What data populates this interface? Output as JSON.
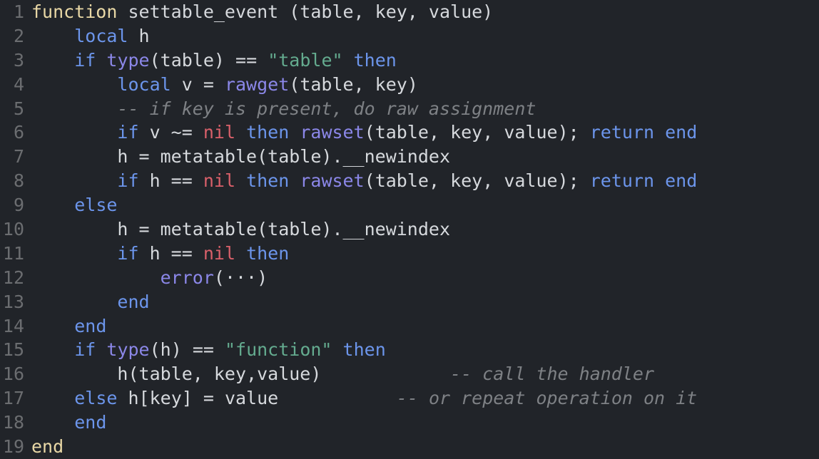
{
  "editor": {
    "language": "lua",
    "background_color": "#212429",
    "gutter_color": "#6b6d70",
    "default_text_color": "#d6d9dd",
    "colors": {
      "keyword": "#6c95eb",
      "function": "#8b87e8",
      "string": "#64ab8f",
      "constant_nil": "#d9606a",
      "definition": "#e9d8a6",
      "comment": "#7e8185"
    },
    "lines": [
      {
        "number": "1",
        "indent": 0,
        "tokens": [
          {
            "text": "function",
            "type": "def"
          },
          {
            "text": " settable_event (table, key, value)",
            "type": "plain"
          }
        ]
      },
      {
        "number": "2",
        "indent": 4,
        "tokens": [
          {
            "text": "local",
            "type": "kw"
          },
          {
            "text": " h",
            "type": "plain"
          }
        ]
      },
      {
        "number": "3",
        "indent": 4,
        "tokens": [
          {
            "text": "if",
            "type": "kw"
          },
          {
            "text": " ",
            "type": "plain"
          },
          {
            "text": "type",
            "type": "fn"
          },
          {
            "text": "(table) == ",
            "type": "plain"
          },
          {
            "text": "\"table\"",
            "type": "str"
          },
          {
            "text": " ",
            "type": "plain"
          },
          {
            "text": "then",
            "type": "kw"
          }
        ]
      },
      {
        "number": "4",
        "indent": 8,
        "tokens": [
          {
            "text": "local",
            "type": "kw"
          },
          {
            "text": " v = ",
            "type": "plain"
          },
          {
            "text": "rawget",
            "type": "fn"
          },
          {
            "text": "(table, key)",
            "type": "plain"
          }
        ]
      },
      {
        "number": "5",
        "indent": 8,
        "tokens": [
          {
            "text": "-- if key is present, do raw assignment",
            "type": "com"
          }
        ]
      },
      {
        "number": "6",
        "indent": 8,
        "tokens": [
          {
            "text": "if",
            "type": "kw"
          },
          {
            "text": " v ~= ",
            "type": "plain"
          },
          {
            "text": "nil",
            "type": "nil"
          },
          {
            "text": " ",
            "type": "plain"
          },
          {
            "text": "then",
            "type": "kw"
          },
          {
            "text": " ",
            "type": "plain"
          },
          {
            "text": "rawset",
            "type": "fn"
          },
          {
            "text": "(table, key, value); ",
            "type": "plain"
          },
          {
            "text": "return",
            "type": "kw"
          },
          {
            "text": " ",
            "type": "plain"
          },
          {
            "text": "end",
            "type": "kw"
          }
        ]
      },
      {
        "number": "7",
        "indent": 8,
        "tokens": [
          {
            "text": "h = metatable(table).__newindex",
            "type": "plain"
          }
        ]
      },
      {
        "number": "8",
        "indent": 8,
        "tokens": [
          {
            "text": "if",
            "type": "kw"
          },
          {
            "text": " h == ",
            "type": "plain"
          },
          {
            "text": "nil",
            "type": "nil"
          },
          {
            "text": " ",
            "type": "plain"
          },
          {
            "text": "then",
            "type": "kw"
          },
          {
            "text": " ",
            "type": "plain"
          },
          {
            "text": "rawset",
            "type": "fn"
          },
          {
            "text": "(table, key, value); ",
            "type": "plain"
          },
          {
            "text": "return",
            "type": "kw"
          },
          {
            "text": " ",
            "type": "plain"
          },
          {
            "text": "end",
            "type": "kw"
          }
        ]
      },
      {
        "number": "9",
        "indent": 4,
        "tokens": [
          {
            "text": "else",
            "type": "kw"
          }
        ]
      },
      {
        "number": "10",
        "indent": 8,
        "tokens": [
          {
            "text": "h = metatable(table).__newindex",
            "type": "plain"
          }
        ]
      },
      {
        "number": "11",
        "indent": 8,
        "tokens": [
          {
            "text": "if",
            "type": "kw"
          },
          {
            "text": " h == ",
            "type": "plain"
          },
          {
            "text": "nil",
            "type": "nil"
          },
          {
            "text": " ",
            "type": "plain"
          },
          {
            "text": "then",
            "type": "kw"
          }
        ]
      },
      {
        "number": "12",
        "indent": 12,
        "tokens": [
          {
            "text": "error",
            "type": "fn"
          },
          {
            "text": "(···)",
            "type": "plain"
          }
        ]
      },
      {
        "number": "13",
        "indent": 8,
        "tokens": [
          {
            "text": "end",
            "type": "kw"
          }
        ]
      },
      {
        "number": "14",
        "indent": 4,
        "tokens": [
          {
            "text": "end",
            "type": "kw"
          }
        ]
      },
      {
        "number": "15",
        "indent": 4,
        "tokens": [
          {
            "text": "if",
            "type": "kw"
          },
          {
            "text": " ",
            "type": "plain"
          },
          {
            "text": "type",
            "type": "fn"
          },
          {
            "text": "(h) == ",
            "type": "plain"
          },
          {
            "text": "\"function\"",
            "type": "str"
          },
          {
            "text": " ",
            "type": "plain"
          },
          {
            "text": "then",
            "type": "kw"
          }
        ]
      },
      {
        "number": "16",
        "indent": 8,
        "tokens": [
          {
            "text": "h(table, key,value)",
            "type": "plain"
          },
          {
            "text": "            ",
            "type": "plain"
          },
          {
            "text": "-- call the handler",
            "type": "com"
          }
        ]
      },
      {
        "number": "17",
        "indent": 4,
        "tokens": [
          {
            "text": "else",
            "type": "kw"
          },
          {
            "text": " h[key] = value",
            "type": "plain"
          },
          {
            "text": "           ",
            "type": "plain"
          },
          {
            "text": "-- or repeat operation on it",
            "type": "com"
          }
        ]
      },
      {
        "number": "18",
        "indent": 4,
        "tokens": [
          {
            "text": "end",
            "type": "kw"
          }
        ]
      },
      {
        "number": "19",
        "indent": 0,
        "tokens": [
          {
            "text": "end",
            "type": "def"
          }
        ]
      }
    ]
  }
}
